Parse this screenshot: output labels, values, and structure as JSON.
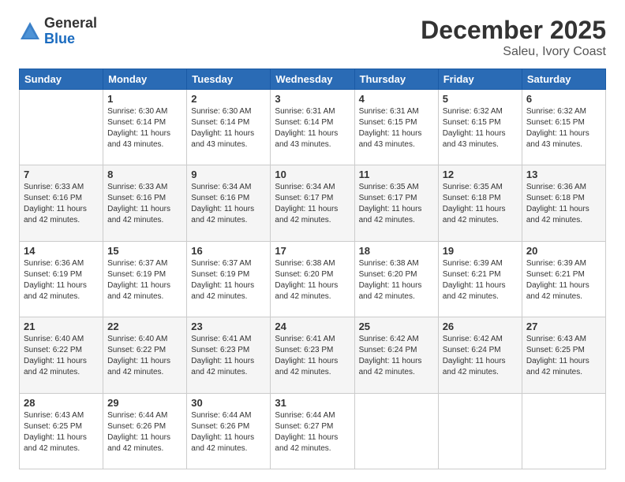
{
  "header": {
    "logo": {
      "general": "General",
      "blue": "Blue"
    },
    "title": "December 2025",
    "location": "Saleu, Ivory Coast"
  },
  "days_of_week": [
    "Sunday",
    "Monday",
    "Tuesday",
    "Wednesday",
    "Thursday",
    "Friday",
    "Saturday"
  ],
  "weeks": [
    [
      {
        "day": "",
        "sunrise": "",
        "sunset": "",
        "daylight": ""
      },
      {
        "day": "1",
        "sunrise": "Sunrise: 6:30 AM",
        "sunset": "Sunset: 6:14 PM",
        "daylight": "Daylight: 11 hours and 43 minutes."
      },
      {
        "day": "2",
        "sunrise": "Sunrise: 6:30 AM",
        "sunset": "Sunset: 6:14 PM",
        "daylight": "Daylight: 11 hours and 43 minutes."
      },
      {
        "day": "3",
        "sunrise": "Sunrise: 6:31 AM",
        "sunset": "Sunset: 6:14 PM",
        "daylight": "Daylight: 11 hours and 43 minutes."
      },
      {
        "day": "4",
        "sunrise": "Sunrise: 6:31 AM",
        "sunset": "Sunset: 6:15 PM",
        "daylight": "Daylight: 11 hours and 43 minutes."
      },
      {
        "day": "5",
        "sunrise": "Sunrise: 6:32 AM",
        "sunset": "Sunset: 6:15 PM",
        "daylight": "Daylight: 11 hours and 43 minutes."
      },
      {
        "day": "6",
        "sunrise": "Sunrise: 6:32 AM",
        "sunset": "Sunset: 6:15 PM",
        "daylight": "Daylight: 11 hours and 43 minutes."
      }
    ],
    [
      {
        "day": "7",
        "sunrise": "Sunrise: 6:33 AM",
        "sunset": "Sunset: 6:16 PM",
        "daylight": "Daylight: 11 hours and 42 minutes."
      },
      {
        "day": "8",
        "sunrise": "Sunrise: 6:33 AM",
        "sunset": "Sunset: 6:16 PM",
        "daylight": "Daylight: 11 hours and 42 minutes."
      },
      {
        "day": "9",
        "sunrise": "Sunrise: 6:34 AM",
        "sunset": "Sunset: 6:16 PM",
        "daylight": "Daylight: 11 hours and 42 minutes."
      },
      {
        "day": "10",
        "sunrise": "Sunrise: 6:34 AM",
        "sunset": "Sunset: 6:17 PM",
        "daylight": "Daylight: 11 hours and 42 minutes."
      },
      {
        "day": "11",
        "sunrise": "Sunrise: 6:35 AM",
        "sunset": "Sunset: 6:17 PM",
        "daylight": "Daylight: 11 hours and 42 minutes."
      },
      {
        "day": "12",
        "sunrise": "Sunrise: 6:35 AM",
        "sunset": "Sunset: 6:18 PM",
        "daylight": "Daylight: 11 hours and 42 minutes."
      },
      {
        "day": "13",
        "sunrise": "Sunrise: 6:36 AM",
        "sunset": "Sunset: 6:18 PM",
        "daylight": "Daylight: 11 hours and 42 minutes."
      }
    ],
    [
      {
        "day": "14",
        "sunrise": "Sunrise: 6:36 AM",
        "sunset": "Sunset: 6:19 PM",
        "daylight": "Daylight: 11 hours and 42 minutes."
      },
      {
        "day": "15",
        "sunrise": "Sunrise: 6:37 AM",
        "sunset": "Sunset: 6:19 PM",
        "daylight": "Daylight: 11 hours and 42 minutes."
      },
      {
        "day": "16",
        "sunrise": "Sunrise: 6:37 AM",
        "sunset": "Sunset: 6:19 PM",
        "daylight": "Daylight: 11 hours and 42 minutes."
      },
      {
        "day": "17",
        "sunrise": "Sunrise: 6:38 AM",
        "sunset": "Sunset: 6:20 PM",
        "daylight": "Daylight: 11 hours and 42 minutes."
      },
      {
        "day": "18",
        "sunrise": "Sunrise: 6:38 AM",
        "sunset": "Sunset: 6:20 PM",
        "daylight": "Daylight: 11 hours and 42 minutes."
      },
      {
        "day": "19",
        "sunrise": "Sunrise: 6:39 AM",
        "sunset": "Sunset: 6:21 PM",
        "daylight": "Daylight: 11 hours and 42 minutes."
      },
      {
        "day": "20",
        "sunrise": "Sunrise: 6:39 AM",
        "sunset": "Sunset: 6:21 PM",
        "daylight": "Daylight: 11 hours and 42 minutes."
      }
    ],
    [
      {
        "day": "21",
        "sunrise": "Sunrise: 6:40 AM",
        "sunset": "Sunset: 6:22 PM",
        "daylight": "Daylight: 11 hours and 42 minutes."
      },
      {
        "day": "22",
        "sunrise": "Sunrise: 6:40 AM",
        "sunset": "Sunset: 6:22 PM",
        "daylight": "Daylight: 11 hours and 42 minutes."
      },
      {
        "day": "23",
        "sunrise": "Sunrise: 6:41 AM",
        "sunset": "Sunset: 6:23 PM",
        "daylight": "Daylight: 11 hours and 42 minutes."
      },
      {
        "day": "24",
        "sunrise": "Sunrise: 6:41 AM",
        "sunset": "Sunset: 6:23 PM",
        "daylight": "Daylight: 11 hours and 42 minutes."
      },
      {
        "day": "25",
        "sunrise": "Sunrise: 6:42 AM",
        "sunset": "Sunset: 6:24 PM",
        "daylight": "Daylight: 11 hours and 42 minutes."
      },
      {
        "day": "26",
        "sunrise": "Sunrise: 6:42 AM",
        "sunset": "Sunset: 6:24 PM",
        "daylight": "Daylight: 11 hours and 42 minutes."
      },
      {
        "day": "27",
        "sunrise": "Sunrise: 6:43 AM",
        "sunset": "Sunset: 6:25 PM",
        "daylight": "Daylight: 11 hours and 42 minutes."
      }
    ],
    [
      {
        "day": "28",
        "sunrise": "Sunrise: 6:43 AM",
        "sunset": "Sunset: 6:25 PM",
        "daylight": "Daylight: 11 hours and 42 minutes."
      },
      {
        "day": "29",
        "sunrise": "Sunrise: 6:44 AM",
        "sunset": "Sunset: 6:26 PM",
        "daylight": "Daylight: 11 hours and 42 minutes."
      },
      {
        "day": "30",
        "sunrise": "Sunrise: 6:44 AM",
        "sunset": "Sunset: 6:26 PM",
        "daylight": "Daylight: 11 hours and 42 minutes."
      },
      {
        "day": "31",
        "sunrise": "Sunrise: 6:44 AM",
        "sunset": "Sunset: 6:27 PM",
        "daylight": "Daylight: 11 hours and 42 minutes."
      },
      {
        "day": "",
        "sunrise": "",
        "sunset": "",
        "daylight": ""
      },
      {
        "day": "",
        "sunrise": "",
        "sunset": "",
        "daylight": ""
      },
      {
        "day": "",
        "sunrise": "",
        "sunset": "",
        "daylight": ""
      }
    ]
  ]
}
